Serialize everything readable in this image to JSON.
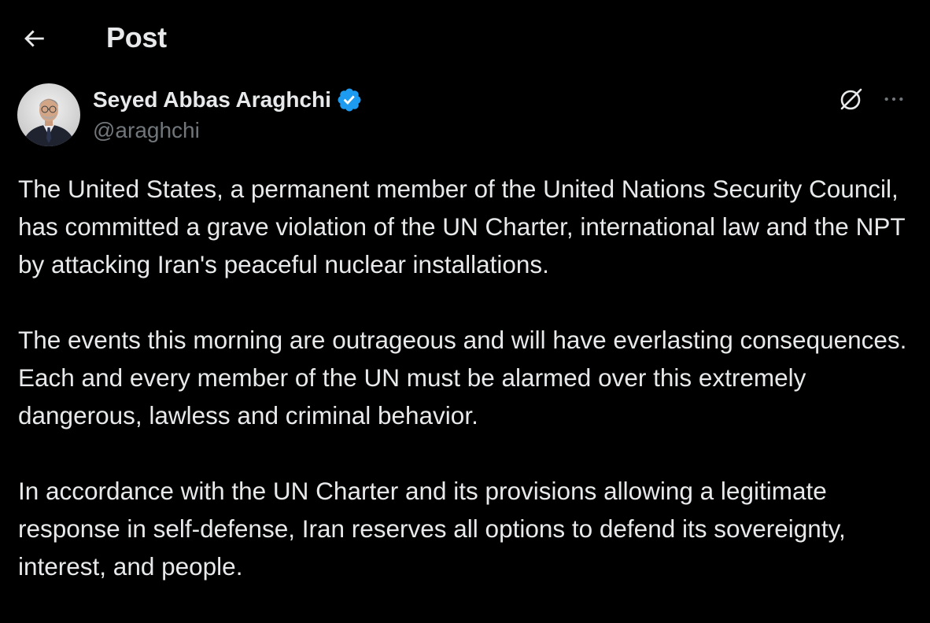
{
  "header": {
    "title": "Post",
    "back_icon": "arrow-left-icon"
  },
  "author": {
    "name": "Seyed Abbas Araghchi",
    "handle": "@araghchi",
    "verified": true,
    "verified_color": "#1d9bf0"
  },
  "actions": {
    "grok_icon": "grok-icon",
    "more_icon": "more-horizontal-icon"
  },
  "post": {
    "paragraphs": [
      "The United States, a permanent member of the United Nations Security Council, has committed a grave violation of the UN Charter, international law and the NPT by attacking Iran's peaceful nuclear installations.",
      "The events this morning are outrageous and will have everlasting consequences. Each and every member of the UN must be alarmed over this extremely dangerous, lawless and criminal behavior.",
      "In accordance with the UN Charter and its provisions allowing a legitimate response in self-defense, Iran reserves all options to defend its sovereignty, interest, and people."
    ]
  },
  "colors": {
    "background": "#000000",
    "text": "#e7e9ea",
    "secondary_text": "#71767b",
    "accent": "#1d9bf0"
  }
}
